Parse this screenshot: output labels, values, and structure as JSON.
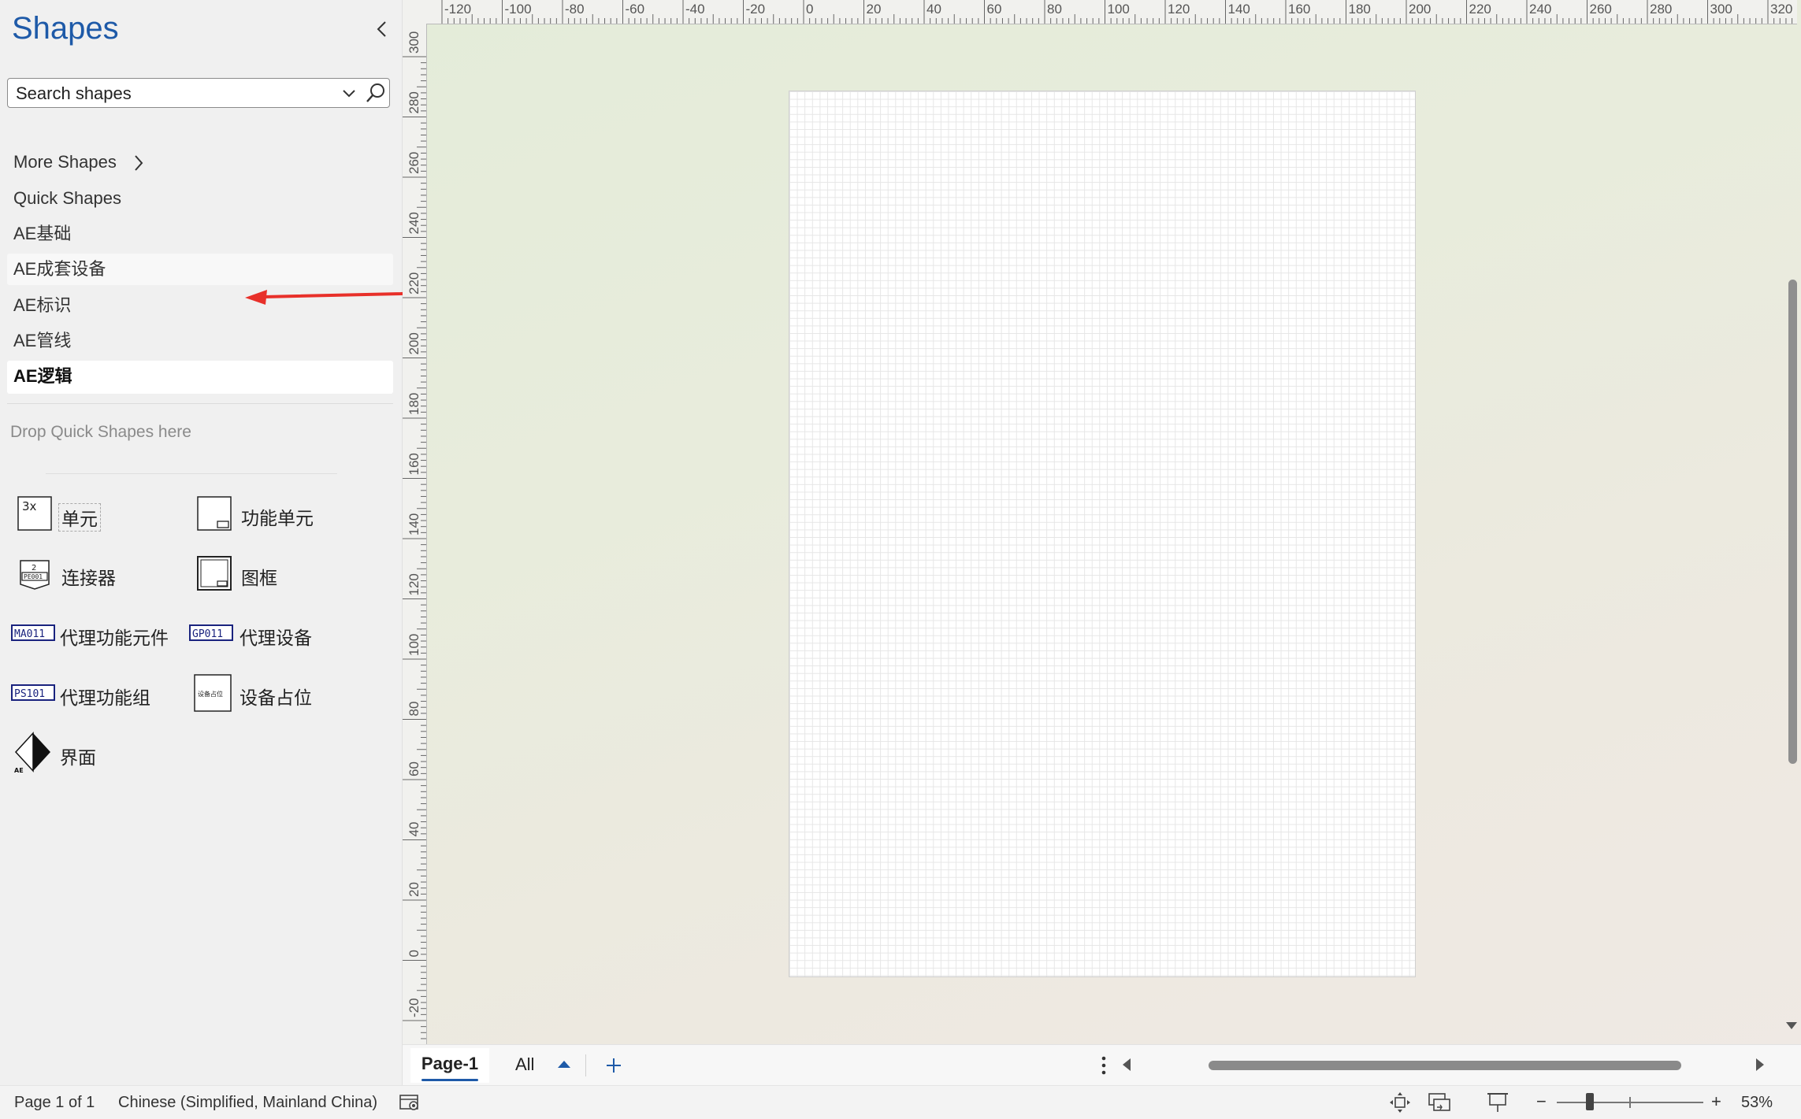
{
  "pane": {
    "title": "Shapes",
    "search_placeholder": "Search shapes",
    "more_shapes": "More Shapes",
    "stencils": [
      "Quick Shapes",
      "AE基础",
      "AE成套设备",
      "AE标识",
      "AE管线",
      "AE逻辑"
    ],
    "active_stencil": "AE逻辑",
    "drop_hint": "Drop Quick Shapes here"
  },
  "shapes": [
    {
      "label": "单元",
      "icon": "unit-icon"
    },
    {
      "label": "功能单元",
      "icon": "function-unit-icon"
    },
    {
      "label": "连接器",
      "icon": "connector-icon"
    },
    {
      "label": "图框",
      "icon": "frame-icon"
    },
    {
      "label": "代理功能元件",
      "icon": "proxy-function-element-icon",
      "icon_text": "MA011"
    },
    {
      "label": "代理设备",
      "icon": "proxy-device-icon",
      "icon_text": "GP011"
    },
    {
      "label": "代理功能组",
      "icon": "proxy-function-group-icon",
      "icon_text": "PS101"
    },
    {
      "label": "设备占位",
      "icon": "device-placeholder-icon",
      "icon_text": "设备占位"
    },
    {
      "label": "界面",
      "icon": "interface-icon"
    }
  ],
  "rulers": {
    "horizontal": [
      "-120",
      "-100",
      "-80",
      "-60",
      "-40",
      "-20",
      "0",
      "20",
      "40",
      "60",
      "80",
      "100",
      "120",
      "140",
      "160",
      "180",
      "200",
      "220",
      "240",
      "260",
      "280",
      "300",
      "320"
    ],
    "vertical": [
      "300",
      "280",
      "260",
      "240",
      "220",
      "200",
      "180",
      "160",
      "140",
      "120",
      "100",
      "80",
      "60",
      "40",
      "20",
      "0",
      "-20"
    ]
  },
  "tabs": {
    "current": "Page-1",
    "all": "All"
  },
  "status": {
    "page_info": "Page 1 of 1",
    "language": "Chinese (Simplified, Mainland China)",
    "zoom": "53%",
    "zoom_minus": "−",
    "zoom_plus": "+"
  },
  "colors": {
    "accent": "#1e5aa8",
    "annotation_arrow": "#e8302a"
  }
}
